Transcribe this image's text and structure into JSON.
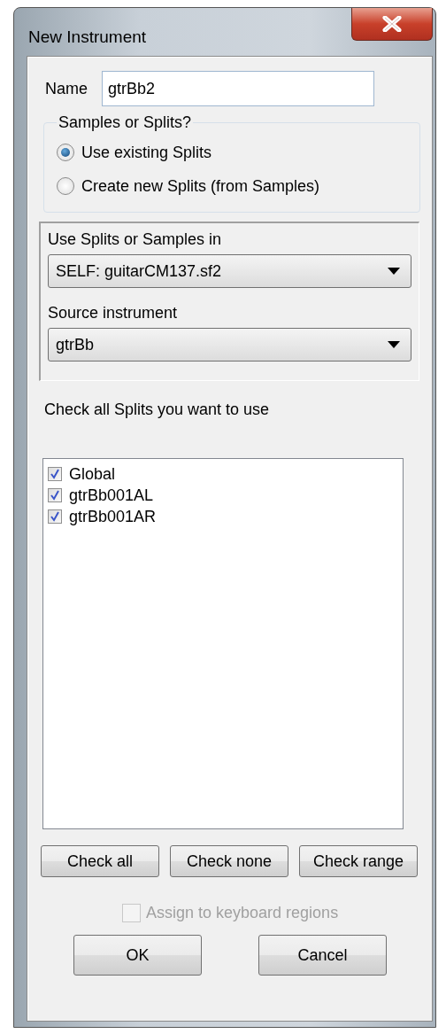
{
  "window": {
    "title": "New Instrument"
  },
  "name_field": {
    "label": "Name",
    "value": "gtrBb2"
  },
  "samples_group": {
    "title": "Samples or Splits?",
    "options": [
      {
        "label": "Use existing Splits",
        "selected": true
      },
      {
        "label": "Create new Splits (from Samples)",
        "selected": false
      }
    ]
  },
  "source_panel": {
    "use_label": "Use Splits or Samples in",
    "use_value": "SELF: guitarCM137.sf2",
    "instrument_label": "Source instrument",
    "instrument_value": "gtrBb"
  },
  "splits_prompt": "Check all Splits you want to use",
  "splits": [
    {
      "label": "Global",
      "checked": true
    },
    {
      "label": "gtrBb001AL",
      "checked": true
    },
    {
      "label": "gtrBb001AR",
      "checked": true
    }
  ],
  "check_buttons": [
    "Check all",
    "Check none",
    "Check range"
  ],
  "assign": {
    "label": "Assign to keyboard regions",
    "checked": false,
    "disabled": true
  },
  "buttons": [
    "OK",
    "Cancel"
  ]
}
